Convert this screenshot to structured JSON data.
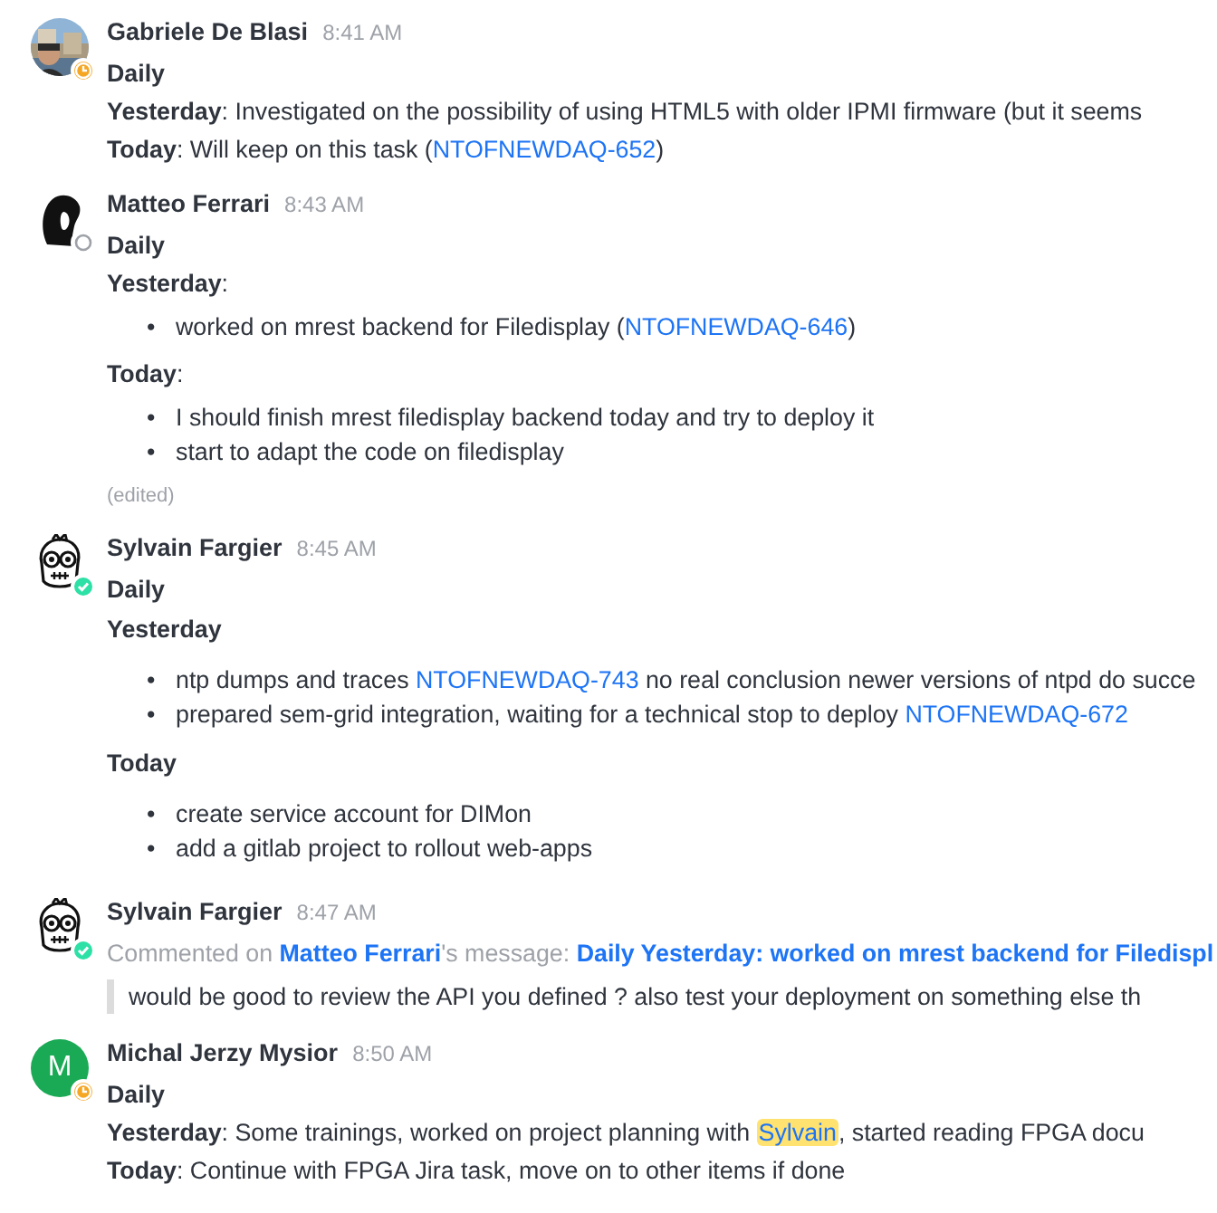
{
  "messages": [
    {
      "author": "Gabriele De Blasi",
      "time": "8:41 AM",
      "badge": {
        "kind": "away"
      },
      "avatar": {
        "kind": "picture"
      },
      "body": [
        {
          "kind": "title",
          "text": "Daily"
        },
        {
          "kind": "line",
          "parts": [
            {
              "kind": "bold",
              "text": "Yesterday"
            },
            {
              "kind": "text",
              "text": ": Investigated on the possibility of using HTML5 with older IPMI firmware (but it seems"
            }
          ]
        },
        {
          "kind": "line",
          "parts": [
            {
              "kind": "bold",
              "text": "Today"
            },
            {
              "kind": "text",
              "text": ": Will keep on this task ("
            },
            {
              "kind": "link",
              "text": "NTOFNEWDAQ-652"
            },
            {
              "kind": "text",
              "text": ")"
            }
          ]
        }
      ]
    },
    {
      "author": "Matteo Ferrari",
      "time": "8:43 AM",
      "badge": {
        "kind": "offline"
      },
      "avatar": {
        "kind": "silhouette"
      },
      "edited_label": "(edited)",
      "body": [
        {
          "kind": "title",
          "text": "Daily"
        },
        {
          "kind": "line",
          "parts": [
            {
              "kind": "bold",
              "text": "Yesterday"
            },
            {
              "kind": "text",
              "text": ":"
            }
          ]
        },
        {
          "kind": "list",
          "items": [
            {
              "bullet": "•",
              "parts": [
                {
                  "kind": "text",
                  "text": "worked on mrest backend for Filedisplay ("
                },
                {
                  "kind": "link",
                  "text": "NTOFNEWDAQ-646"
                },
                {
                  "kind": "text",
                  "text": ")"
                }
              ]
            }
          ]
        },
        {
          "kind": "line",
          "parts": [
            {
              "kind": "bold",
              "text": "Today"
            },
            {
              "kind": "text",
              "text": ":"
            }
          ]
        },
        {
          "kind": "list",
          "items": [
            {
              "bullet": "•",
              "parts": [
                {
                  "kind": "text",
                  "text": "I should finish mrest filedisplay backend today and try to deploy it"
                }
              ]
            },
            {
              "bullet": "•",
              "parts": [
                {
                  "kind": "text",
                  "text": "start to adapt the code on filedisplay"
                }
              ]
            }
          ]
        }
      ]
    },
    {
      "author": "Sylvain Fargier",
      "time": "8:45 AM",
      "badge": {
        "kind": "online"
      },
      "avatar": {
        "kind": "cartoon"
      },
      "body": [
        {
          "kind": "title",
          "text": "Daily"
        },
        {
          "kind": "heading",
          "text": "Yesterday"
        },
        {
          "kind": "list",
          "items": [
            {
              "bullet": "•",
              "parts": [
                {
                  "kind": "text",
                  "text": "ntp dumps and traces "
                },
                {
                  "kind": "link",
                  "text": "NTOFNEWDAQ-743"
                },
                {
                  "kind": "text",
                  "text": " no real conclusion newer versions of ntpd do succe"
                }
              ]
            },
            {
              "bullet": "•",
              "parts": [
                {
                  "kind": "text",
                  "text": "prepared sem-grid integration, waiting for a technical stop to deploy "
                },
                {
                  "kind": "link",
                  "text": "NTOFNEWDAQ-672"
                }
              ]
            }
          ]
        },
        {
          "kind": "heading",
          "text": "Today"
        },
        {
          "kind": "list",
          "items": [
            {
              "bullet": "•",
              "parts": [
                {
                  "kind": "text",
                  "text": "create service account for DIMon"
                }
              ]
            },
            {
              "bullet": "•",
              "parts": [
                {
                  "kind": "text",
                  "text": "add a gitlab project to rollout web-apps"
                }
              ]
            }
          ]
        }
      ]
    },
    {
      "author": "Sylvain Fargier",
      "time": "8:47 AM",
      "badge": {
        "kind": "online"
      },
      "avatar": {
        "kind": "cartoon"
      },
      "body": [
        {
          "kind": "comment",
          "parts": [
            {
              "kind": "muted",
              "text": "Commented on "
            },
            {
              "kind": "boldlink",
              "text": "Matteo Ferrari"
            },
            {
              "kind": "muted",
              "text": "'s message: "
            },
            {
              "kind": "boldlink",
              "text": "Daily Yesterday: worked on mrest backend for Filedispl"
            }
          ]
        },
        {
          "kind": "quote",
          "text": "would be good to review the API you defined ? also test your deployment on something else th"
        }
      ]
    },
    {
      "author": "Michal Jerzy Mysior",
      "time": "8:50 AM",
      "badge": {
        "kind": "away"
      },
      "avatar": {
        "kind": "initial",
        "letter": "M",
        "color": "#1aaa55"
      },
      "body": [
        {
          "kind": "title",
          "text": "Daily"
        },
        {
          "kind": "line",
          "parts": [
            {
              "kind": "bold",
              "text": "Yesterday"
            },
            {
              "kind": "text",
              "text": ": Some trainings, worked on project planning with "
            },
            {
              "kind": "mention",
              "text": "Sylvain"
            },
            {
              "kind": "text",
              "text": ", started reading FPGA docu"
            }
          ]
        },
        {
          "kind": "line",
          "parts": [
            {
              "kind": "bold",
              "text": "Today"
            },
            {
              "kind": "text",
              "text": ": Continue with FPGA Jira task, move on to other items if done"
            }
          ]
        }
      ]
    }
  ]
}
